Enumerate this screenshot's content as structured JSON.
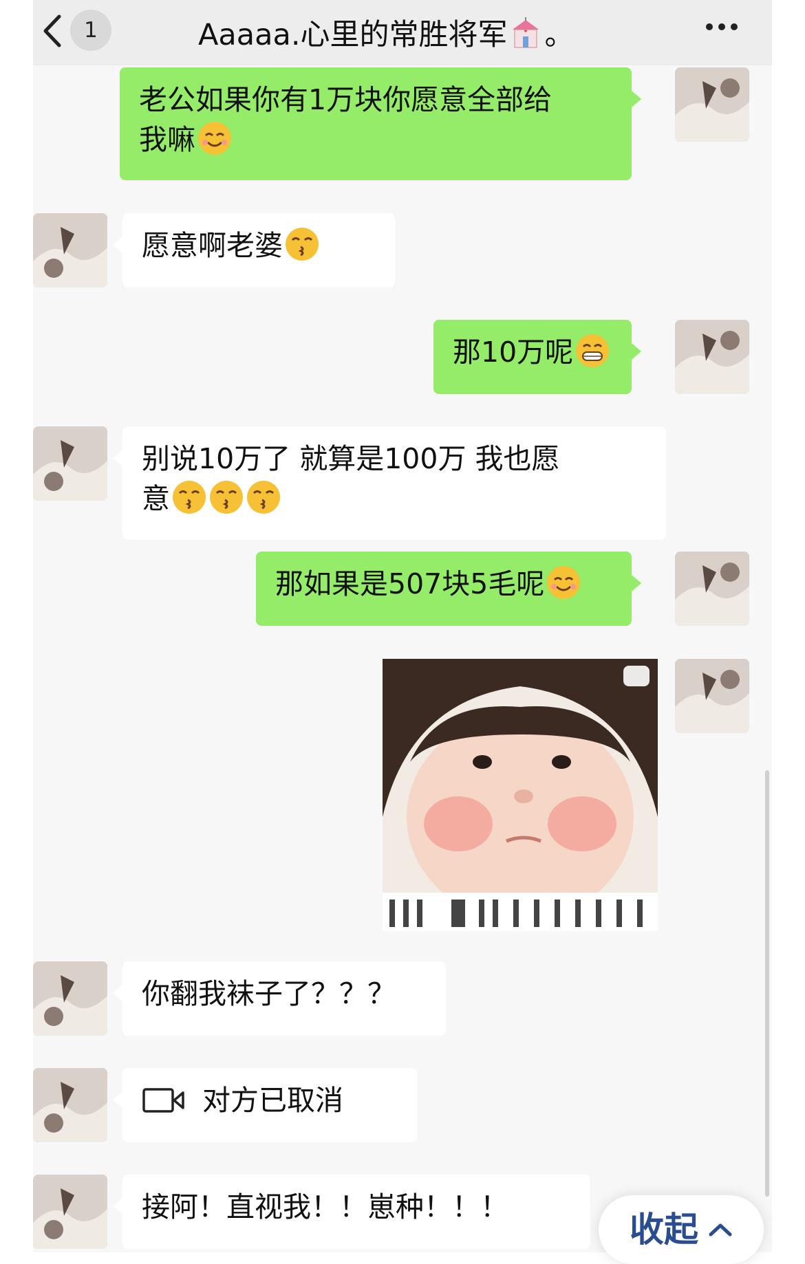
{
  "header": {
    "unread_count": "1",
    "title": "Aaaaa.心里的常胜将军",
    "title_suffix": "。",
    "title_emoji": "wedding-chapel-emoji"
  },
  "messages": [
    {
      "side": "out",
      "text_line1": "老公如果你有1万块你愿意全部给",
      "text_line2": "我嘛",
      "emoji": "smiling-emoji"
    },
    {
      "side": "in",
      "text": "愿意啊老婆",
      "emoji": "kissing-emoji"
    },
    {
      "side": "out",
      "text": "那10万呢",
      "emoji": "grinning-emoji"
    },
    {
      "side": "in",
      "text_line1": "别说10万了 就算是100万 我也愿",
      "text_line2": "意",
      "emoji": "kissing-emoji x3"
    },
    {
      "side": "out",
      "text": "那如果是507块5毛呢",
      "emoji": "smiling-emoji"
    },
    {
      "side": "out",
      "type": "sticker",
      "alt": "chubby-baby-sticker"
    },
    {
      "side": "in",
      "text": "你翻我袜子了？？？"
    },
    {
      "side": "in",
      "type": "video-call",
      "text": "对方已取消"
    },
    {
      "side": "in",
      "text": "接阿！直视我！！崽种！！！"
    }
  ],
  "collapse_button": {
    "label": "收起"
  },
  "colors": {
    "outgoing_bubble": "#95ec69",
    "incoming_bubble": "#ffffff",
    "background": "#f7f7f7",
    "header": "#ededed"
  }
}
